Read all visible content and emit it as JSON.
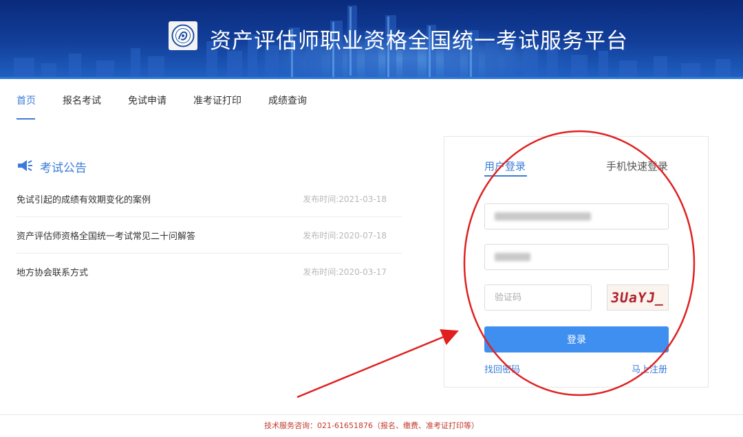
{
  "header": {
    "title": "资产评估师职业资格全国统一考试服务平台",
    "logo_icon": "association-seal-icon",
    "colors": {
      "banner_top": "#0a2a7c",
      "banner_bottom": "#1f5fc0",
      "accent": "#3a7cd8"
    }
  },
  "nav": {
    "items": [
      {
        "label": "首页",
        "active": true
      },
      {
        "label": "报名考试",
        "active": false
      },
      {
        "label": "免试申请",
        "active": false
      },
      {
        "label": "准考证打印",
        "active": false
      },
      {
        "label": "成绩查询",
        "active": false
      }
    ]
  },
  "announcements": {
    "title": "考试公告",
    "icon": "megaphone-icon",
    "items": [
      {
        "text": "免试引起的成绩有效期变化的案例",
        "date": "发布时间:2021-03-18"
      },
      {
        "text": "资产评估师资格全国统一考试常见二十问解答",
        "date": "发布时间:2020-07-18"
      },
      {
        "text": "地方协会联系方式",
        "date": "发布时间:2020-03-17"
      }
    ]
  },
  "login": {
    "tabs": [
      {
        "label": "用户登录",
        "active": true
      },
      {
        "label": "手机快速登录",
        "active": false
      }
    ],
    "username_value": "(blurred)",
    "password_value": "(blurred)",
    "captcha_placeholder": "验证码",
    "captcha_text": "3UaYJ_",
    "submit_label": "登录",
    "forgot_label": "找回密码",
    "register_label": "马上注册",
    "button_color": "#3f8ff0"
  },
  "annotations": {
    "circle_color": "#e02020",
    "arrow_color": "#e02020"
  },
  "footer": {
    "text": "技术服务咨询：021-61651876（报名、缴费、准考证打印等）"
  }
}
